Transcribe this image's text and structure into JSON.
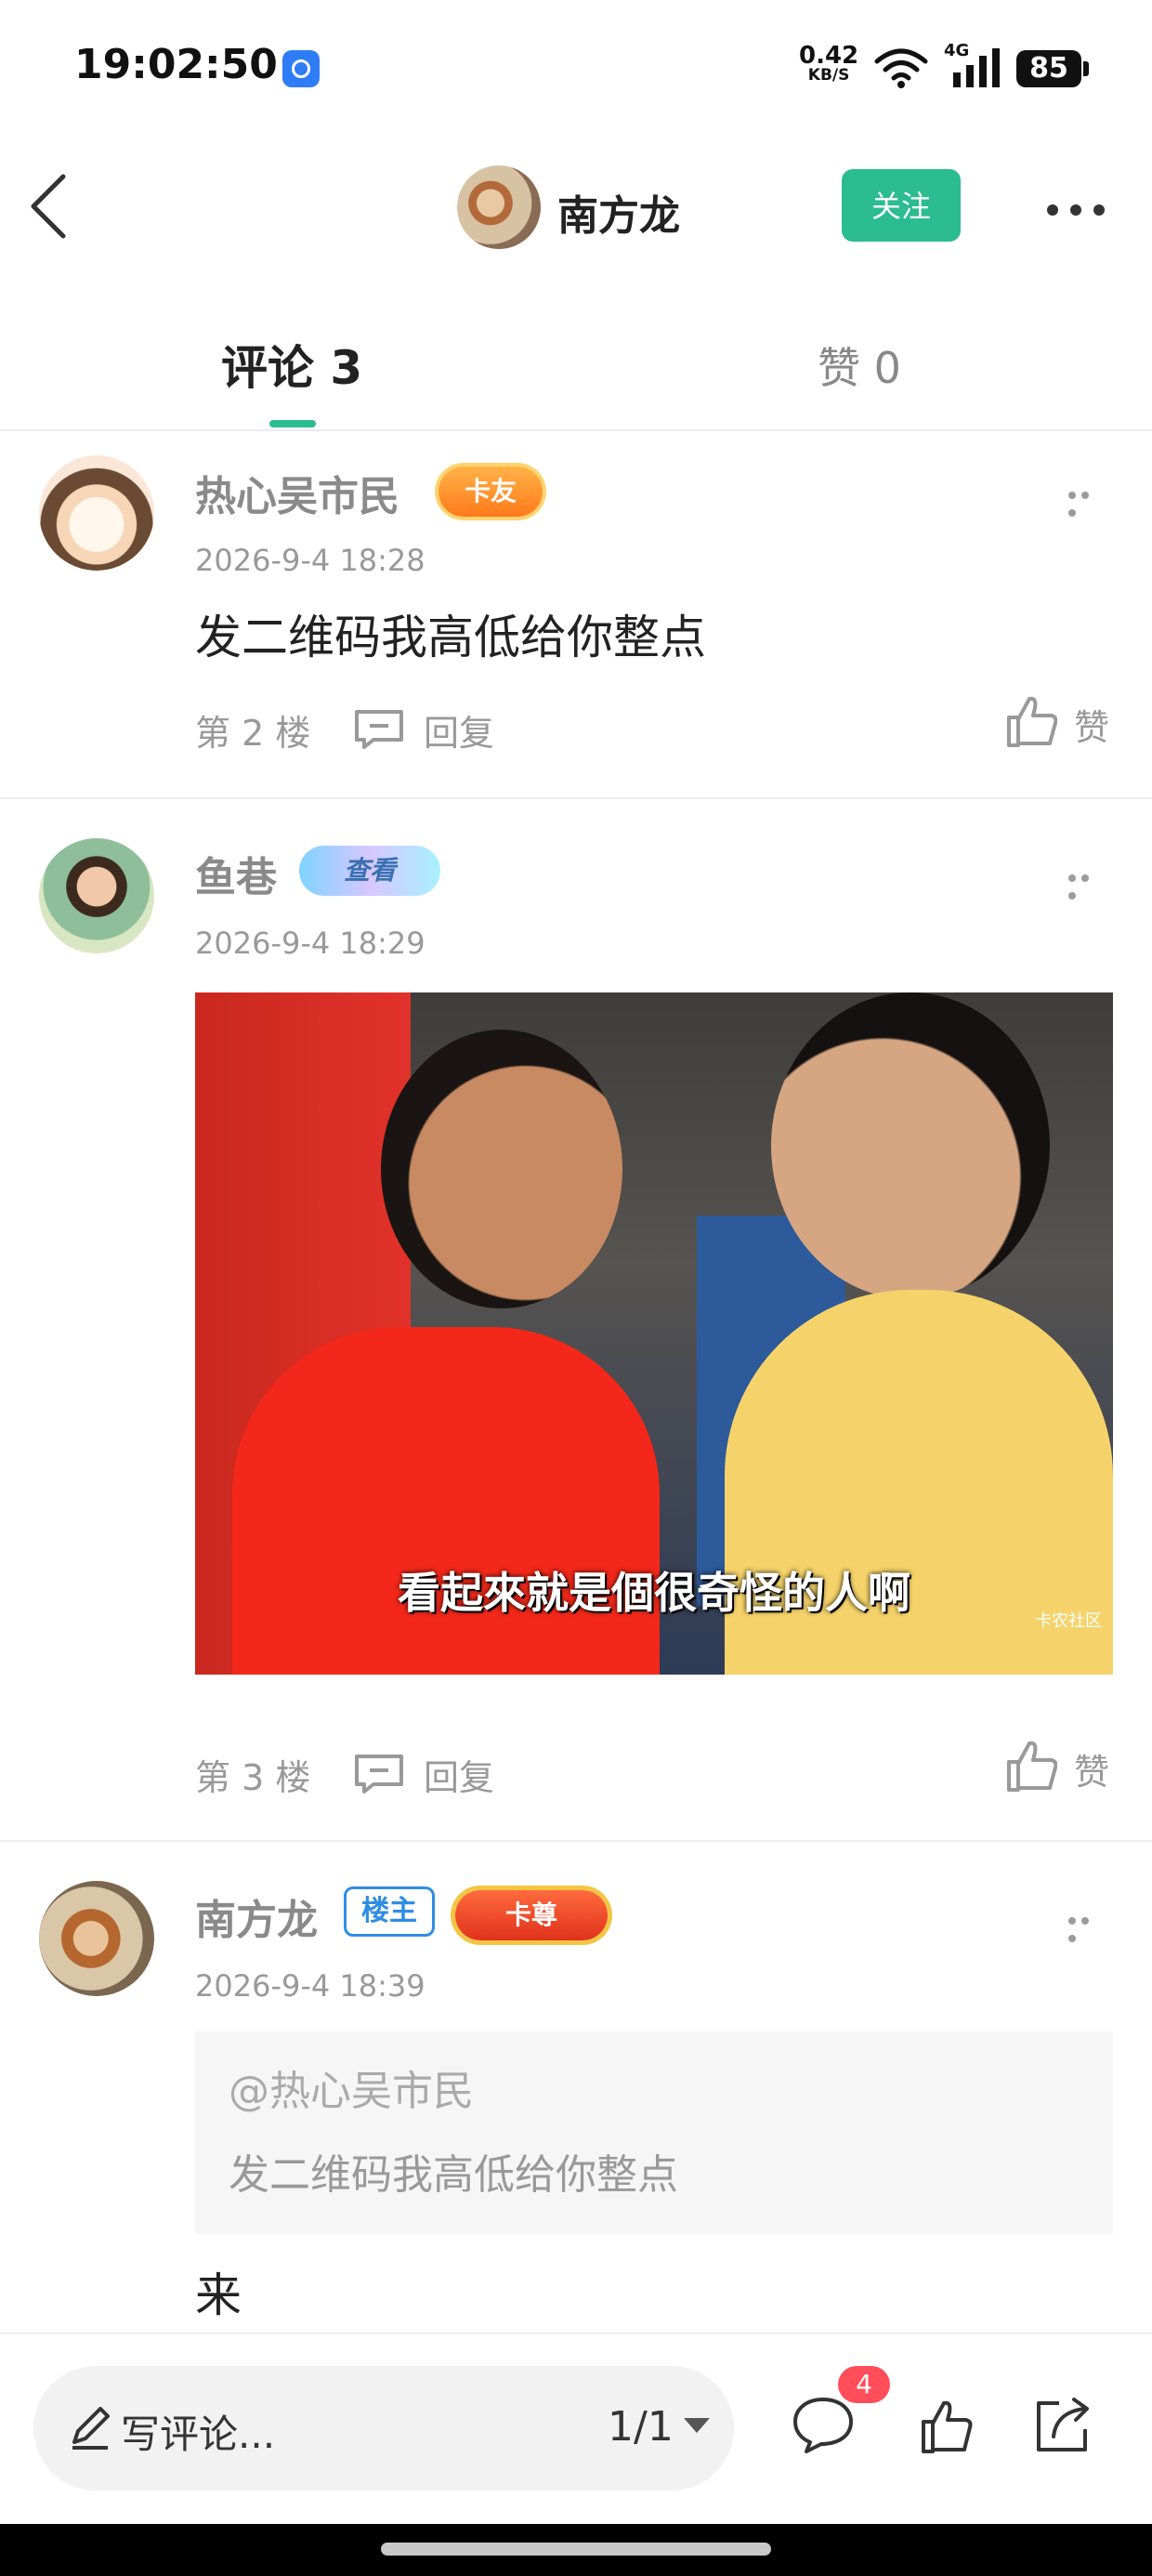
{
  "status_bar": {
    "time": "19:02:50",
    "net_speed": "0.42",
    "net_speed_unit": "KB/S",
    "network": "4G",
    "battery": "85"
  },
  "header": {
    "author_name": "南方龙",
    "follow_label": "关注",
    "back_icon": "chevron-left-icon",
    "more_icon": "more-horizontal-icon"
  },
  "tabs": {
    "comments_label": "评论 3",
    "likes_label": "赞 0"
  },
  "comments": [
    {
      "author": "热心吴市民",
      "badge": "卡友",
      "time": "2026-9-4 18:28",
      "text": "发二维码我高低给你整点",
      "floor": "第 2 楼",
      "reply_label": "回复",
      "like_label": "赞"
    },
    {
      "author": "鱼巷",
      "badge": "查看",
      "time": "2026-9-4 18:29",
      "image_caption": "看起來就是個很奇怪的人啊",
      "image_watermark": "卡农社区",
      "floor": "第 3 楼",
      "reply_label": "回复",
      "like_label": "赞"
    },
    {
      "author": "南方龙",
      "owner_tag": "楼主",
      "badge": "卡尊",
      "time": "2026-9-4 18:39",
      "quote_user": "@热心吴市民",
      "quote_text": "发二维码我高低给你整点",
      "text": "来"
    }
  ],
  "bottom_bar": {
    "input_placeholder": "写评论...",
    "page_indicator": "1/1",
    "comment_count_badge": "4"
  },
  "colors": {
    "accent": "#2bbc8f",
    "notification": "#ff4d5a"
  }
}
